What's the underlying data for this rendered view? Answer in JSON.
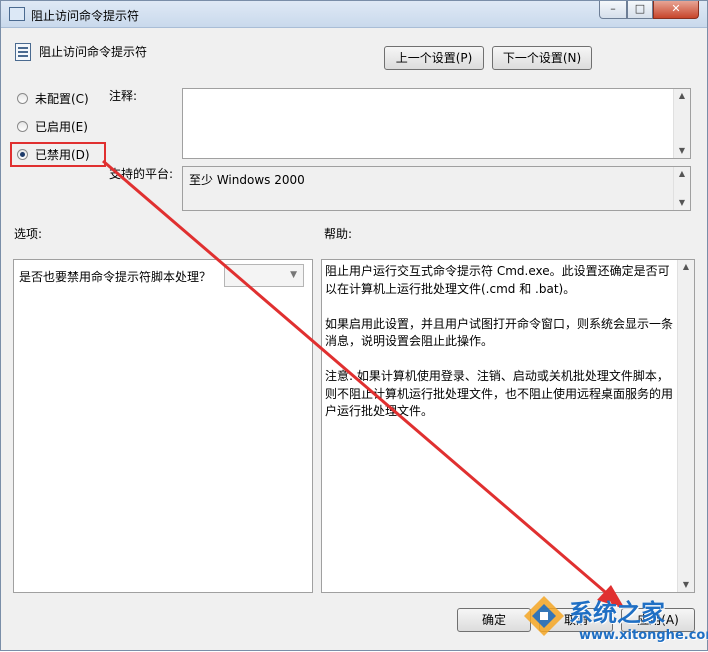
{
  "window": {
    "title": "阻止访问命令提示符",
    "minimize_glyph": "–",
    "maximize_glyph": "□",
    "close_glyph": "✕"
  },
  "header": {
    "policy_title": "阻止访问命令提示符",
    "prev_button": "上一个设置(P)",
    "next_button": "下一个设置(N)"
  },
  "state_options": [
    {
      "label": "未配置(C)",
      "checked": false
    },
    {
      "label": "已启用(E)",
      "checked": false
    },
    {
      "label": "已禁用(D)",
      "checked": true
    }
  ],
  "comment": {
    "label": "注释:",
    "value": ""
  },
  "platform": {
    "label": "支持的平台:",
    "value": "至少 Windows 2000"
  },
  "options": {
    "label": "选项:",
    "question": "是否也要禁用命令提示符脚本处理？",
    "dropdown_value": ""
  },
  "help": {
    "label": "帮助:",
    "text": "阻止用户运行交互式命令提示符 Cmd.exe。此设置还确定是否可以在计算机上运行批处理文件(.cmd 和 .bat)。\n\n如果启用此设置，并且用户试图打开命令窗口，则系统会显示一条消息，说明设置会阻止此操作。\n\n注意: 如果计算机使用登录、注销、启动或关机批处理文件脚本，则不阻止计算机运行批处理文件，也不阻止使用远程桌面服务的用户运行批处理文件。"
  },
  "footer": {
    "ok_button": "确定",
    "cancel_button": "取消",
    "apply_button": "应用(A)"
  },
  "watermark": {
    "brand": "系统之家",
    "url": "www.xitonghe.com"
  },
  "colors": {
    "highlight": "#e03030",
    "arrow": "#e03030",
    "watermark": "#1f6fc4"
  }
}
